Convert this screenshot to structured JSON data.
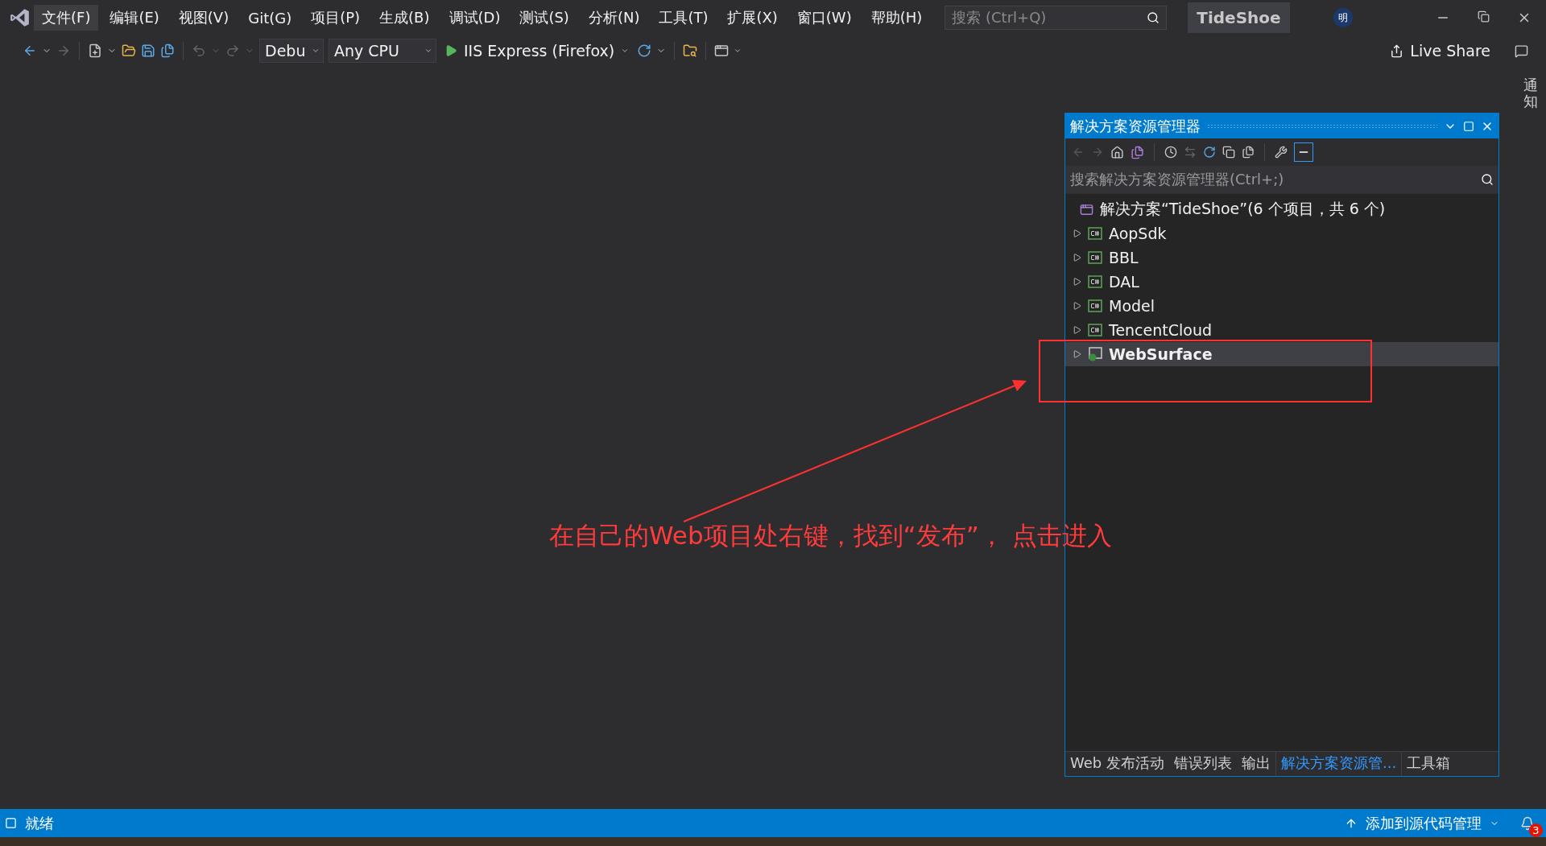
{
  "menu": [
    {
      "label": "文件(F)",
      "selected": true
    },
    {
      "label": "编辑(E)",
      "selected": false
    },
    {
      "label": "视图(V)",
      "selected": false
    },
    {
      "label": "Git(G)",
      "selected": false
    },
    {
      "label": "项目(P)",
      "selected": false
    },
    {
      "label": "生成(B)",
      "selected": false
    },
    {
      "label": "调试(D)",
      "selected": false
    },
    {
      "label": "测试(S)",
      "selected": false
    },
    {
      "label": "分析(N)",
      "selected": false
    },
    {
      "label": "工具(T)",
      "selected": false
    },
    {
      "label": "扩展(X)",
      "selected": false
    },
    {
      "label": "窗口(W)",
      "selected": false
    },
    {
      "label": "帮助(H)",
      "selected": false
    }
  ],
  "search": {
    "placeholder": "搜索 (Ctrl+Q)"
  },
  "solution_badge": "TideShoe",
  "avatar": "明",
  "toolbar": {
    "configuration": "Debu",
    "platform": "Any CPU",
    "run_target": "IIS Express (Firefox)",
    "live_share": "Live Share"
  },
  "side_tab": "通知",
  "solution_explorer": {
    "title": "解决方案资源管理器",
    "search": {
      "placeholder": "搜索解决方案资源管理器(Ctrl+;)"
    },
    "root": "解决方案“TideShoe”(6 个项目，共 6 个)",
    "projects": [
      {
        "name": "AopSdk",
        "kind": "csharp",
        "expanded": false,
        "selected": false,
        "startup": false
      },
      {
        "name": "BBL",
        "kind": "csharp",
        "expanded": false,
        "selected": false,
        "startup": false
      },
      {
        "name": "DAL",
        "kind": "csharp",
        "expanded": false,
        "selected": false,
        "startup": false
      },
      {
        "name": "Model",
        "kind": "csharp",
        "expanded": false,
        "selected": false,
        "startup": false
      },
      {
        "name": "TencentCloud",
        "kind": "csharp",
        "expanded": false,
        "selected": false,
        "startup": false
      },
      {
        "name": "WebSurface",
        "kind": "web",
        "expanded": false,
        "selected": true,
        "startup": true
      }
    ],
    "tabs": [
      {
        "label": "Web 发布活动",
        "selected": false
      },
      {
        "label": "错误列表",
        "selected": false
      },
      {
        "label": "输出",
        "selected": false
      },
      {
        "label": "解决方案资源管...",
        "selected": true
      },
      {
        "label": "工具箱",
        "selected": false
      }
    ]
  },
  "annotation": "在自己的Web项目处右键，找到“发布”， 点击进入",
  "status_bar": {
    "state": "就绪",
    "source_control": "添加到源代码管理",
    "notifications": "3"
  }
}
